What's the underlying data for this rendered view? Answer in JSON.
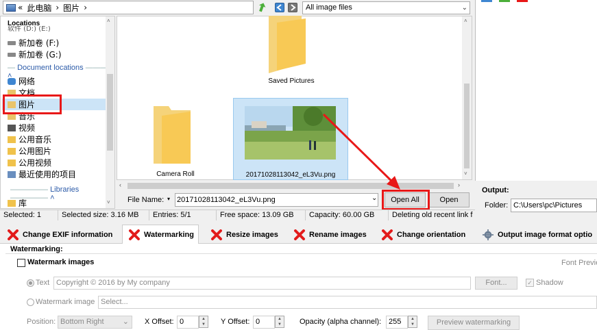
{
  "address_bar": {
    "segments": [
      "«",
      "此电脑",
      "›",
      "图片",
      "›"
    ]
  },
  "file_filter": {
    "value": "All image files"
  },
  "nav": {
    "locations_header": "Locations",
    "partial_top_item": "软件 (D:) (E:)",
    "drives": [
      {
        "label": "新加卷 (F:)",
        "icon": "drive-icon"
      },
      {
        "label": "新加卷 (G:)",
        "icon": "drive-icon"
      }
    ],
    "document_locations_header": "Document locations",
    "doc_items": [
      {
        "label": "网络",
        "icon": "network-icon"
      },
      {
        "label": "文档",
        "icon": "documents-icon"
      },
      {
        "label": "图片",
        "icon": "pictures-icon",
        "selected": true
      },
      {
        "label": "音乐",
        "icon": "music-icon"
      },
      {
        "label": "视频",
        "icon": "video-icon"
      },
      {
        "label": "公用音乐",
        "icon": "folder-icon"
      },
      {
        "label": "公用图片",
        "icon": "folder-icon"
      },
      {
        "label": "公用视频",
        "icon": "folder-icon"
      },
      {
        "label": "最近使用的项目",
        "icon": "recent-icon"
      }
    ],
    "libraries_header": "Libraries",
    "library_items": [
      {
        "label": "库",
        "icon": "library-icon"
      }
    ]
  },
  "files": [
    {
      "name": "Saved Pictures",
      "type": "folder"
    },
    {
      "name": "Camera Roll",
      "type": "folder"
    },
    {
      "name": "20171028113042_eL3Vu.png",
      "type": "image",
      "selected": true
    }
  ],
  "file_name": {
    "label": "File Name:",
    "value": "20171028113042_eL3Vu.png"
  },
  "buttons": {
    "open_all": "Open All",
    "open": "Open"
  },
  "status_bar": {
    "selected": "Selected: 1",
    "selected_size": "Selected size: 3.16 MB",
    "entries": "Entries: 5/1",
    "free_space": "Free space: 13.09 GB",
    "capacity": "Capacity: 60.00 GB",
    "message": "Deleting old recent link f"
  },
  "output": {
    "label": "Output:",
    "folder_label": "Folder:",
    "folder_value": "C:\\Users\\pc\\Pictures"
  },
  "tabs": [
    {
      "label": "Change EXIF information",
      "icon": "red-x-icon"
    },
    {
      "label": "Watermarking",
      "icon": "red-x-icon",
      "active": true
    },
    {
      "label": "Resize images",
      "icon": "red-x-icon"
    },
    {
      "label": "Rename images",
      "icon": "red-x-icon"
    },
    {
      "label": "Change orientation",
      "icon": "red-x-icon"
    },
    {
      "label": "Output image format optio",
      "icon": "gear-icon"
    }
  ],
  "watermarking": {
    "section_title": "Watermarking:",
    "watermark_images_label": "Watermark images",
    "font_preview_label": "Font Previe",
    "text_option": "Text",
    "text_value": "Copyright © 2016 by My company",
    "font_button": "Font...",
    "shadow_label": "Shadow",
    "image_option": "Watermark image",
    "image_placeholder": "Select...",
    "position_label": "Position:",
    "position_value": "Bottom Right",
    "x_offset_label": "X Offset:",
    "x_offset_value": "0",
    "y_offset_label": "Y Offset:",
    "y_offset_value": "0",
    "opacity_label": "Opacity (alpha channel):",
    "opacity_value": "255",
    "preview_button": "Preview watermarking"
  },
  "colors": {
    "annotation_red": "#e81818",
    "selection_blue": "#cce4f7",
    "link_blue": "#2b5aa8"
  }
}
